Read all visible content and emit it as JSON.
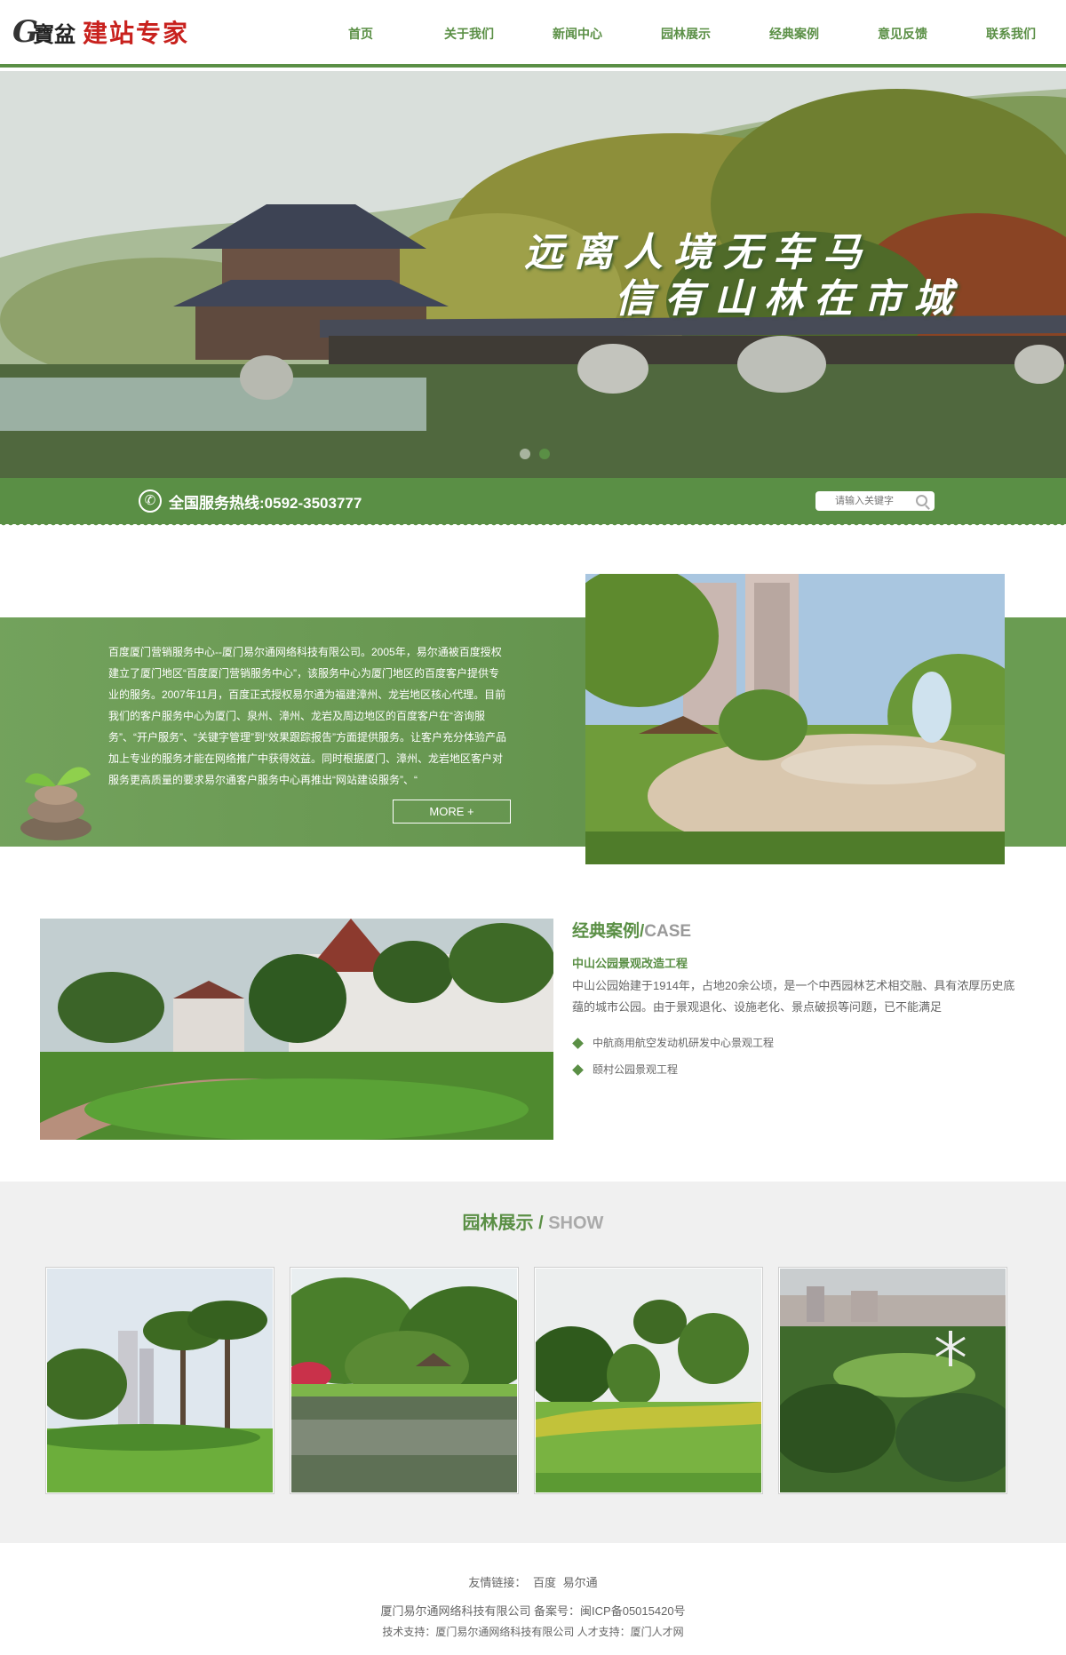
{
  "header": {
    "logo_g": "G",
    "logo_bao": "寶盆",
    "logo_text": "建站专家",
    "nav": [
      "首页",
      "关于我们",
      "新闻中心",
      "园林展示",
      "经典案例",
      "意见反馈",
      "联系我们"
    ]
  },
  "banner": {
    "line1": "远离人境无车马",
    "line2": "信有山林在市城"
  },
  "hotline": {
    "label": "全国服务热线:0592-3503777",
    "search_placeholder": "请输入关键字"
  },
  "about": {
    "text": "百度厦门营销服务中心--厦门易尔通网络科技有限公司。2005年，易尔通被百度授权建立了厦门地区“百度厦门营销服务中心”，该服务中心为厦门地区的百度客户提供专业的服务。2007年11月，百度正式授权易尔通为福建漳州、龙岩地区核心代理。目前我们的客户服务中心为厦门、泉州、漳州、龙岩及周边地区的百度客户在“咨询服务”、“开户服务”、“关键字管理”到“效果跟踪报告”方面提供服务。让客户充分体验产品加上专业的服务才能在网络推广中获得效益。同时根据厦门、漳州、龙岩地区客户对服务更高质量的要求易尔通客户服务中心再推出“网站建设服务”、“",
    "more": "MORE +"
  },
  "case": {
    "title": "经典案例/",
    "title_en": "CASE",
    "subtitle": "中山公园景观改造工程",
    "desc": "中山公园始建于1914年，占地20余公顷，是一个中西园林艺术相交融、具有浓厚历史底蕴的城市公园。由于景观退化、设施老化、景点破损等问题，已不能满足",
    "items": [
      "中航商用航空发动机研发中心景观工程",
      "颐村公园景观工程"
    ]
  },
  "show": {
    "title": "园林展示 / ",
    "title_en": "SHOW"
  },
  "footer": {
    "links_label": "友情链接：",
    "links": [
      "百度",
      "易尔通"
    ],
    "company": "厦门易尔通网络科技有限公司 备案号：闽ICP备05015420号",
    "support": "技术支持：厦门易尔通网络科技有限公司 人才支持：厦门人才网"
  },
  "colors": {
    "brand_green": "#5a8f45",
    "logo_red": "#c8211d"
  }
}
